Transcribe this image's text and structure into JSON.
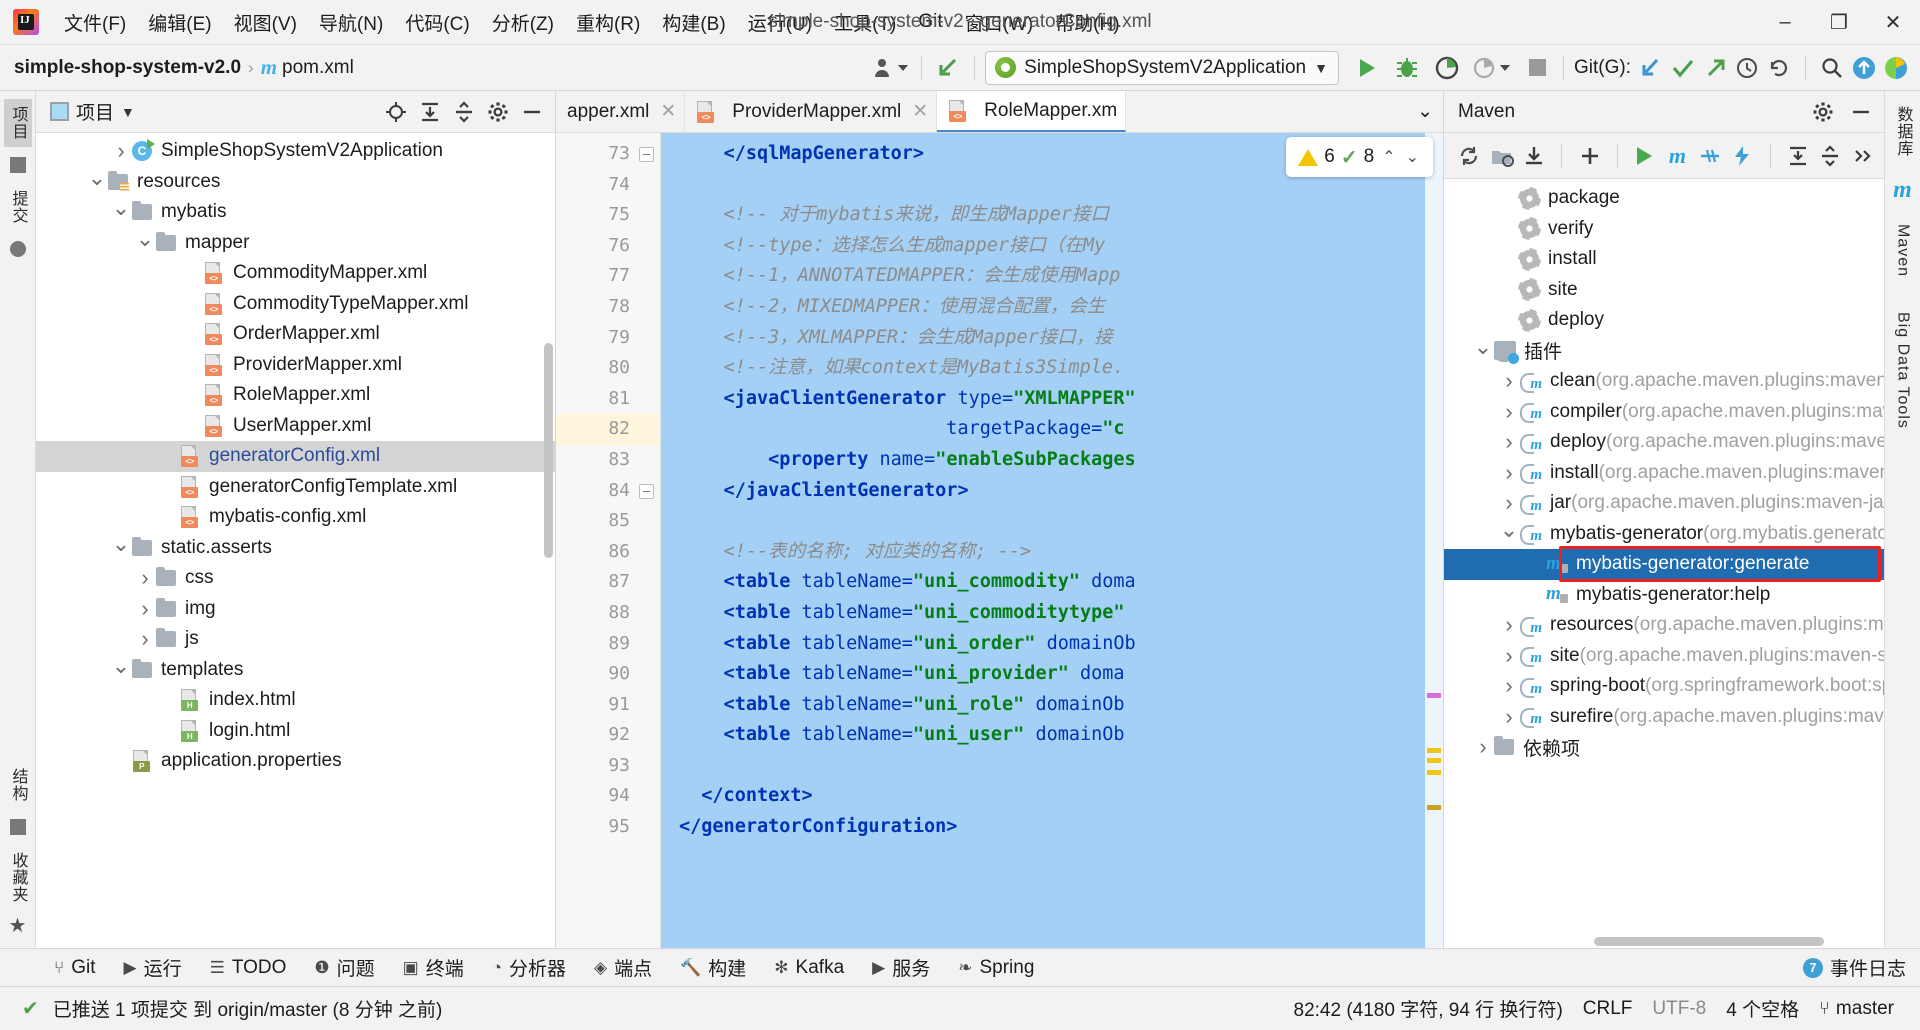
{
  "window": {
    "title": "simple-shop-system-v2 - generatorConfig.xml",
    "minimize": "–",
    "maximize": "❐",
    "close": "✕"
  },
  "menubar": {
    "items": [
      {
        "label": "文件(F)"
      },
      {
        "label": "编辑(E)"
      },
      {
        "label": "视图(V)"
      },
      {
        "label": "导航(N)"
      },
      {
        "label": "代码(C)"
      },
      {
        "label": "分析(Z)"
      },
      {
        "label": "重构(R)"
      },
      {
        "label": "构建(B)"
      },
      {
        "label": "运行(U)"
      },
      {
        "label": "工具(T)"
      },
      {
        "label": "Git"
      },
      {
        "label": "窗口(W)"
      },
      {
        "label": "帮助(H)"
      }
    ]
  },
  "toolbar": {
    "breadcrumb_project": "simple-shop-system-v2.0",
    "breadcrumb_sep": "›",
    "breadcrumb_file": "pom.xml",
    "run_config": "SimpleShopSystemV2Application",
    "run_config_caret": "▼",
    "git_label": "Git(G):",
    "buttons": {
      "run": "run-triangle",
      "debug": "debug-bug",
      "run_coverage": "coverage",
      "profiler": "profiler",
      "stop": "stop-square",
      "update": "update-project",
      "commit": "commit-check",
      "push": "push-arrow",
      "history": "history-clock",
      "rollback": "rollback",
      "search": "search-magnifier",
      "upload": "upload-circle",
      "ide_assist": "assistant"
    }
  },
  "left_strip": {
    "items": [
      "项目",
      "提交",
      "结构",
      "收藏夹"
    ]
  },
  "right_strip": {
    "items": [
      "数据库",
      "Maven",
      "Big Data Tools"
    ]
  },
  "project_panel": {
    "title": "项目",
    "caret": "▼",
    "tools": [
      "locate-target-icon",
      "expand-all-icon",
      "collapse-all-icon",
      "gear-icon",
      "hide-icon"
    ],
    "tree": [
      {
        "label": "SimpleShopSystemV2Application",
        "indent": 3,
        "arrow": "right",
        "icon": "class",
        "sel": false
      },
      {
        "label": "resources",
        "indent": 2,
        "arrow": "down",
        "icon": "folder-res",
        "sel": false
      },
      {
        "label": "mybatis",
        "indent": 3,
        "arrow": "down",
        "icon": "folder",
        "sel": false
      },
      {
        "label": "mapper",
        "indent": 4,
        "arrow": "down",
        "icon": "folder",
        "sel": false
      },
      {
        "label": "CommodityMapper.xml",
        "indent": 6,
        "arrow": "none",
        "icon": "xml",
        "sel": false
      },
      {
        "label": "CommodityTypeMapper.xml",
        "indent": 6,
        "arrow": "none",
        "icon": "xml",
        "sel": false
      },
      {
        "label": "OrderMapper.xml",
        "indent": 6,
        "arrow": "none",
        "icon": "xml",
        "sel": false
      },
      {
        "label": "ProviderMapper.xml",
        "indent": 6,
        "arrow": "none",
        "icon": "xml",
        "sel": false
      },
      {
        "label": "RoleMapper.xml",
        "indent": 6,
        "arrow": "none",
        "icon": "xml",
        "sel": false
      },
      {
        "label": "UserMapper.xml",
        "indent": 6,
        "arrow": "none",
        "icon": "xml",
        "sel": false
      },
      {
        "label": "generatorConfig.xml",
        "indent": 5,
        "arrow": "none",
        "icon": "xml",
        "sel": true
      },
      {
        "label": "generatorConfigTemplate.xml",
        "indent": 5,
        "arrow": "none",
        "icon": "xml",
        "sel": false
      },
      {
        "label": "mybatis-config.xml",
        "indent": 5,
        "arrow": "none",
        "icon": "xml",
        "sel": false
      },
      {
        "label": "static.asserts",
        "indent": 3,
        "arrow": "down",
        "icon": "folder",
        "sel": false
      },
      {
        "label": "css",
        "indent": 4,
        "arrow": "right",
        "icon": "folder",
        "sel": false
      },
      {
        "label": "img",
        "indent": 4,
        "arrow": "right",
        "icon": "folder",
        "sel": false
      },
      {
        "label": "js",
        "indent": 4,
        "arrow": "right",
        "icon": "folder",
        "sel": false
      },
      {
        "label": "templates",
        "indent": 3,
        "arrow": "down",
        "icon": "folder",
        "sel": false
      },
      {
        "label": "index.html",
        "indent": 5,
        "arrow": "none",
        "icon": "html",
        "sel": false
      },
      {
        "label": "login.html",
        "indent": 5,
        "arrow": "none",
        "icon": "html",
        "sel": false
      },
      {
        "label": "application.properties",
        "indent": 3,
        "arrow": "none",
        "icon": "prop",
        "sel": false
      }
    ]
  },
  "editor": {
    "tabs": [
      {
        "label": "apper.xml",
        "icon": "xml",
        "active": false,
        "close": "✕",
        "clipped": true
      },
      {
        "label": "ProviderMapper.xml",
        "icon": "xml",
        "active": false,
        "close": "✕"
      },
      {
        "label": "RoleMapper.xm",
        "icon": "xml",
        "active": true,
        "close": ""
      }
    ],
    "tabs_more": "⌄",
    "inspection_widget": {
      "warnings": "6",
      "checks": "8",
      "prev": "⌃",
      "next": "⌄"
    },
    "lines": [
      {
        "n": "73",
        "parts": [
          {
            "t": "    ",
            "c": "plain"
          },
          {
            "t": "</sqlMapGenerator>",
            "c": "tag"
          }
        ]
      },
      {
        "n": "74",
        "parts": []
      },
      {
        "n": "75",
        "parts": [
          {
            "t": "    <!-- 对于mybatis来说，即生成Mapper接口",
            "c": "cmt"
          }
        ]
      },
      {
        "n": "76",
        "parts": [
          {
            "t": "    <!--type：选择怎么生成mapper接口（在My",
            "c": "cmt"
          }
        ]
      },
      {
        "n": "77",
        "parts": [
          {
            "t": "    <!--1，ANNOTATEDMAPPER：会生成使用Mapp",
            "c": "cmt"
          }
        ]
      },
      {
        "n": "78",
        "parts": [
          {
            "t": "    <!--2，MIXEDMAPPER：使用混合配置，会生",
            "c": "cmt"
          }
        ]
      },
      {
        "n": "79",
        "parts": [
          {
            "t": "    <!--3，XMLMAPPER：会生成Mapper接口，接",
            "c": "cmt"
          }
        ]
      },
      {
        "n": "80",
        "parts": [
          {
            "t": "    <!--注意，如果context是MyBatis3Simple.",
            "c": "cmt"
          }
        ]
      },
      {
        "n": "81",
        "parts": [
          {
            "t": "    <javaClientGenerator",
            "c": "tag"
          },
          {
            "t": " type=",
            "c": "attr"
          },
          {
            "t": "\"XMLMAPPER\"",
            "c": "str"
          }
        ]
      },
      {
        "n": "82",
        "parts": [
          {
            "t": "                        targetPackage=",
            "c": "attr"
          },
          {
            "t": "\"c",
            "c": "str"
          }
        ],
        "current": true
      },
      {
        "n": "83",
        "parts": [
          {
            "t": "        <property",
            "c": "tag"
          },
          {
            "t": " name=",
            "c": "attr"
          },
          {
            "t": "\"enableSubPackages",
            "c": "str"
          }
        ]
      },
      {
        "n": "84",
        "parts": [
          {
            "t": "    </javaClientGenerator>",
            "c": "tag"
          }
        ]
      },
      {
        "n": "85",
        "parts": []
      },
      {
        "n": "86",
        "parts": [
          {
            "t": "    <!--表的名称; 对应类的名称; -->",
            "c": "cmt"
          }
        ]
      },
      {
        "n": "87",
        "parts": [
          {
            "t": "    <table",
            "c": "tag"
          },
          {
            "t": " tableName=",
            "c": "attr"
          },
          {
            "t": "\"uni_commodity\"",
            "c": "str"
          },
          {
            "t": " doma",
            "c": "attr"
          }
        ]
      },
      {
        "n": "88",
        "parts": [
          {
            "t": "    <table",
            "c": "tag"
          },
          {
            "t": " tableName=",
            "c": "attr"
          },
          {
            "t": "\"uni_commoditytype\"",
            "c": "str"
          }
        ]
      },
      {
        "n": "89",
        "parts": [
          {
            "t": "    <table",
            "c": "tag"
          },
          {
            "t": " tableName=",
            "c": "attr"
          },
          {
            "t": "\"uni_order\"",
            "c": "str"
          },
          {
            "t": " domainOb",
            "c": "attr"
          }
        ]
      },
      {
        "n": "90",
        "parts": [
          {
            "t": "    <table",
            "c": "tag"
          },
          {
            "t": " tableName=",
            "c": "attr"
          },
          {
            "t": "\"uni_provider\"",
            "c": "str"
          },
          {
            "t": " doma",
            "c": "attr"
          }
        ]
      },
      {
        "n": "91",
        "parts": [
          {
            "t": "    <table",
            "c": "tag"
          },
          {
            "t": " tableName=",
            "c": "attr"
          },
          {
            "t": "\"uni_role\"",
            "c": "str"
          },
          {
            "t": " domainOb",
            "c": "attr"
          }
        ]
      },
      {
        "n": "92",
        "parts": [
          {
            "t": "    <table",
            "c": "tag"
          },
          {
            "t": " tableName=",
            "c": "attr"
          },
          {
            "t": "\"uni_user\"",
            "c": "str"
          },
          {
            "t": " domainOb",
            "c": "attr"
          }
        ]
      },
      {
        "n": "93",
        "parts": []
      },
      {
        "n": "94",
        "parts": [
          {
            "t": "  </context>",
            "c": "tag"
          }
        ]
      },
      {
        "n": "95",
        "parts": [
          {
            "t": "</generatorConfiguration>",
            "c": "tag"
          }
        ]
      }
    ]
  },
  "maven": {
    "title": "Maven",
    "tools": [
      "reload-icon",
      "add-folder-icon",
      "download-sources-icon",
      "add-icon",
      "run-icon",
      "maven-goal-icon",
      "skip-tests-icon",
      "execute-icon",
      "expand-icon",
      "collapse-icon",
      "more-icon"
    ],
    "head_tools": [
      "gear-icon",
      "hide-icon"
    ],
    "tree": [
      {
        "label": "package",
        "sub": "",
        "indent": 2,
        "arrow": "none",
        "icon": "gear",
        "sel": false
      },
      {
        "label": "verify",
        "sub": "",
        "indent": 2,
        "arrow": "none",
        "icon": "gear",
        "sel": false
      },
      {
        "label": "install",
        "sub": "",
        "indent": 2,
        "arrow": "none",
        "icon": "gear",
        "sel": false
      },
      {
        "label": "site",
        "sub": "",
        "indent": 2,
        "arrow": "none",
        "icon": "gear",
        "sel": false
      },
      {
        "label": "deploy",
        "sub": "",
        "indent": 2,
        "arrow": "none",
        "icon": "gear",
        "sel": false
      },
      {
        "label": "插件",
        "sub": "",
        "indent": 1,
        "arrow": "down",
        "icon": "folder-plug",
        "sel": false
      },
      {
        "label": "clean",
        "sub": "(org.apache.maven.plugins:maven-c",
        "indent": 2,
        "arrow": "right",
        "icon": "plug",
        "sel": false
      },
      {
        "label": "compiler",
        "sub": "(org.apache.maven.plugins:mav",
        "indent": 2,
        "arrow": "right",
        "icon": "plug",
        "sel": false
      },
      {
        "label": "deploy",
        "sub": "(org.apache.maven.plugins:maven",
        "indent": 2,
        "arrow": "right",
        "icon": "plug",
        "sel": false
      },
      {
        "label": "install",
        "sub": "(org.apache.maven.plugins:maven-i",
        "indent": 2,
        "arrow": "right",
        "icon": "plug",
        "sel": false
      },
      {
        "label": "jar",
        "sub": "(org.apache.maven.plugins:maven-jar-",
        "indent": 2,
        "arrow": "right",
        "icon": "plug",
        "sel": false
      },
      {
        "label": "mybatis-generator",
        "sub": "(org.mybatis.generator:",
        "indent": 2,
        "arrow": "down",
        "icon": "plug",
        "sel": false
      },
      {
        "label": "mybatis-generator:generate",
        "sub": "",
        "indent": 3,
        "arrow": "none",
        "icon": "goal",
        "sel": true
      },
      {
        "label": "mybatis-generator:help",
        "sub": "",
        "indent": 3,
        "arrow": "none",
        "icon": "goal",
        "sel": false
      },
      {
        "label": "resources",
        "sub": "(org.apache.maven.plugins:ma",
        "indent": 2,
        "arrow": "right",
        "icon": "plug",
        "sel": false
      },
      {
        "label": "site",
        "sub": "(org.apache.maven.plugins:maven-site",
        "indent": 2,
        "arrow": "right",
        "icon": "plug",
        "sel": false
      },
      {
        "label": "spring-boot",
        "sub": "(org.springframework.boot:spr",
        "indent": 2,
        "arrow": "right",
        "icon": "plug",
        "sel": false
      },
      {
        "label": "surefire",
        "sub": "(org.apache.maven.plugins:maven",
        "indent": 2,
        "arrow": "right",
        "icon": "plug",
        "sel": false
      },
      {
        "label": "依赖项",
        "sub": "",
        "indent": 1,
        "arrow": "right",
        "icon": "deps",
        "sel": false
      }
    ]
  },
  "toolwindow_bar": {
    "items": [
      {
        "label": "Git",
        "icon": "git-branch-icon"
      },
      {
        "label": "运行",
        "icon": "run-icon"
      },
      {
        "label": "TODO",
        "icon": "todo-list-icon"
      },
      {
        "label": "问题",
        "icon": "problems-icon"
      },
      {
        "label": "终端",
        "icon": "terminal-icon"
      },
      {
        "label": "分析器",
        "icon": "profiler-icon"
      },
      {
        "label": "端点",
        "icon": "endpoints-icon"
      },
      {
        "label": "构建",
        "icon": "build-hammer-icon"
      },
      {
        "label": "Kafka",
        "icon": "kafka-icon"
      },
      {
        "label": "服务",
        "icon": "services-icon"
      },
      {
        "label": "Spring",
        "icon": "spring-leaf-icon"
      }
    ],
    "right": {
      "label": "事件日志",
      "badge": "7"
    }
  },
  "statusbar": {
    "message": "已推送 1 项提交 到 origin/master (8 分钟 之前)",
    "check_icon": "✔",
    "caret_pos": "82:42 (4180 字符, 94 行 换行符)",
    "line_sep": "CRLF",
    "encoding": "UTF-8",
    "indent": "4 个空格",
    "branch": "master",
    "branch_icon": "⑂"
  }
}
